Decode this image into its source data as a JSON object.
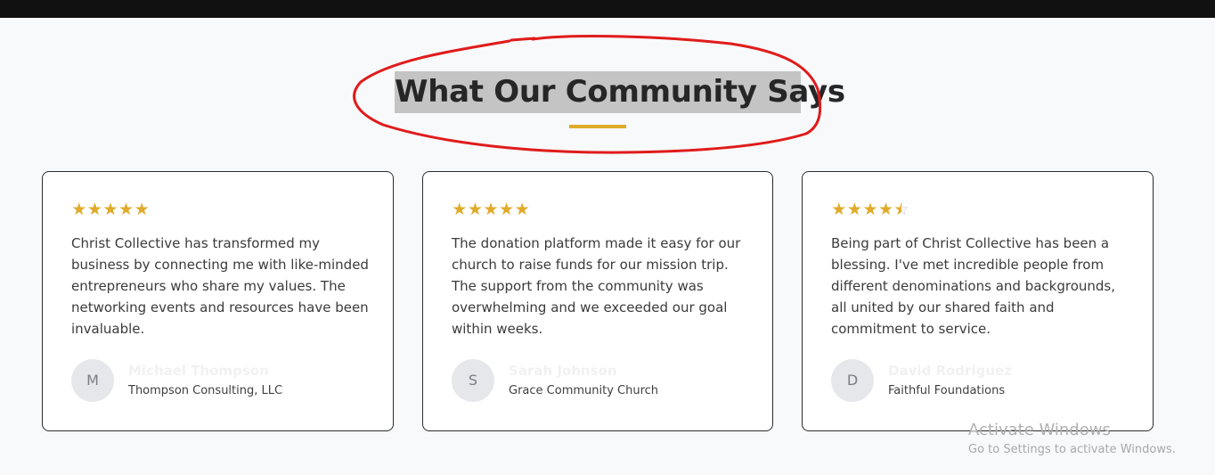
{
  "section": {
    "title": "What Our Community Says",
    "accent_color": "#e0ab2a",
    "annotation_color": "#e01b1b"
  },
  "testimonials": [
    {
      "rating": 5,
      "quote": "Christ Collective has transformed my business by connecting me with like-minded entrepreneurs who share my values. The networking events and resources have been invaluable.",
      "avatar_initial": "M",
      "name": "Michael Thompson",
      "organization": "Thompson Consulting, LLC"
    },
    {
      "rating": 5,
      "quote": "The donation platform made it easy for our church to raise funds for our mission trip. The support from the community was overwhelming and we exceeded our goal within weeks.",
      "avatar_initial": "S",
      "name": "Sarah Johnson",
      "organization": "Grace Community Church"
    },
    {
      "rating": 4.5,
      "quote": "Being part of Christ Collective has been a blessing. I've met incredible people from different denominations and backgrounds, all united by our shared faith and commitment to service.",
      "avatar_initial": "D",
      "name": "David Rodriguez",
      "organization": "Faithful Foundations"
    }
  ],
  "os_watermark": {
    "title": "Activate Windows",
    "subtitle": "Go to Settings to activate Windows."
  }
}
